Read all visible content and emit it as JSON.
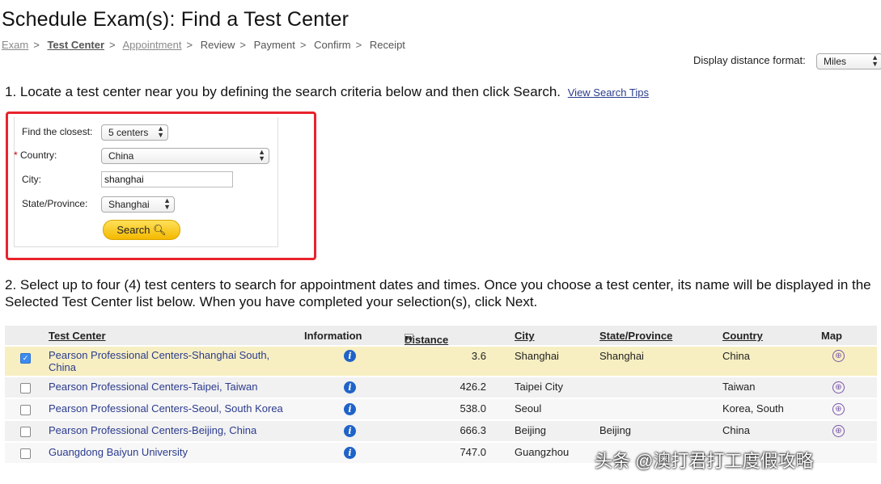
{
  "page_title": "Schedule Exam(s): Find a Test Center",
  "breadcrumb": [
    "Exam",
    "Test Center",
    "Appointment",
    "Review",
    "Payment",
    "Confirm",
    "Receipt"
  ],
  "display_distance": {
    "label": "Display distance format:",
    "value": "Miles"
  },
  "step1": {
    "text": "1. Locate a test center near you by defining the search criteria below and then click Search.",
    "link": "View Search Tips"
  },
  "form": {
    "closest_label": "Find the closest:",
    "closest_value": "5 centers",
    "country_label": "Country:",
    "country_required": "*",
    "country_value": "China",
    "city_label": "City:",
    "city_value": "shanghai",
    "state_label": "State/Province:",
    "state_value": "Shanghai",
    "search_button": "Search"
  },
  "step2": {
    "text": "2. Select up to four (4) test centers to search for appointment dates and times. Once you choose a test center, its name will be displayed in the Selected Test Center list below. When you have completed your selection(s), click Next."
  },
  "table": {
    "headers": {
      "test_center": "Test Center",
      "information": "Information",
      "distance_prefix": "**",
      "distance": "Distance",
      "city": "City",
      "state": "State/Province",
      "country": "Country",
      "map": "Map"
    },
    "rows": [
      {
        "name": "Pearson Professional Centers-Shanghai South, China",
        "distance": "3.6",
        "city": "Shanghai",
        "state": "Shanghai",
        "country": "China",
        "checked": true
      },
      {
        "name": "Pearson Professional Centers-Taipei, Taiwan",
        "distance": "426.2",
        "city": "Taipei City",
        "state": "",
        "country": "Taiwan",
        "checked": false
      },
      {
        "name": "Pearson Professional Centers-Seoul, South Korea",
        "distance": "538.0",
        "city": "Seoul",
        "state": "",
        "country": "Korea, South",
        "checked": false
      },
      {
        "name": "Pearson Professional Centers-Beijing, China",
        "distance": "666.3",
        "city": "Beijing",
        "state": "Beijing",
        "country": "China",
        "checked": false
      },
      {
        "name": "Guangdong Baiyun University",
        "distance": "747.0",
        "city": "Guangzhou",
        "state": "",
        "country": "",
        "checked": false
      }
    ]
  },
  "watermark": "头条 @澳打君打工度假攻略"
}
